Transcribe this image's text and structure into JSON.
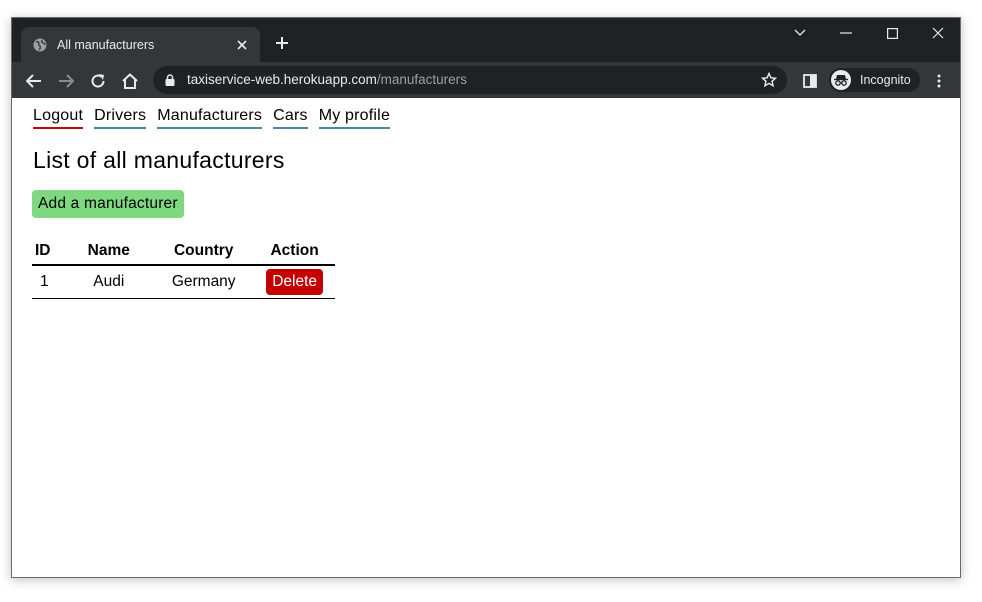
{
  "browser": {
    "tab_title": "All manufacturers",
    "url_host": "taxiservice-web.herokuapp.com",
    "url_path": "/manufacturers",
    "profile_label": "Incognito"
  },
  "nav": {
    "logout": "Logout",
    "drivers": "Drivers",
    "manufacturers": "Manufacturers",
    "cars": "Cars",
    "my_profile": "My profile"
  },
  "page": {
    "title": "List of all manufacturers",
    "add_button": "Add a manufacturer"
  },
  "table": {
    "headers": [
      "ID",
      "Name",
      "Country",
      "Action"
    ],
    "rows": [
      {
        "id": "1",
        "name": "Audi",
        "country": "Germany",
        "action": "Delete"
      }
    ]
  },
  "colors": {
    "add_button": "#7dd87f",
    "delete_button": "#c40000",
    "logout_underline": "#d00000",
    "nav_underline": "#4a8a98"
  }
}
